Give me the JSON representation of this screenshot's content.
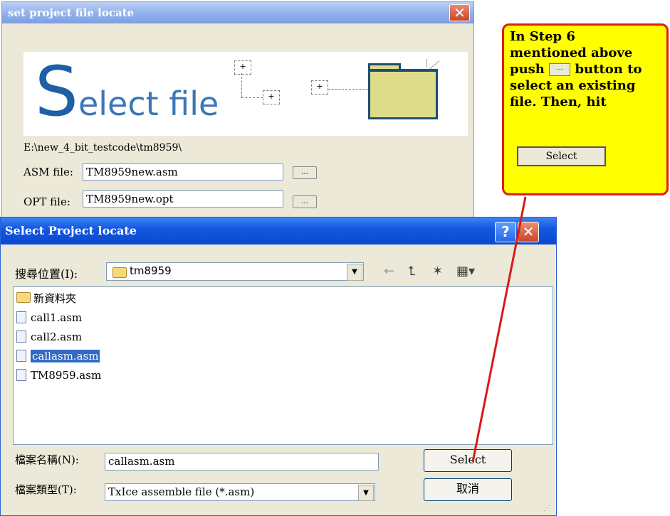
{
  "back_dialog": {
    "title": "set project file locate",
    "close_glyph": "✕",
    "banner": {
      "big_letter": "S",
      "rest": "elect file",
      "plus_glyph": "[+]"
    },
    "path": "E:\\new_4_bit_testcode\\tm8959\\",
    "asm_label": "ASM file:",
    "asm_value": "TM8959new.asm",
    "opt_label": "OPT file:",
    "opt_value": "TM8959new.opt",
    "browse_label": "..."
  },
  "callout": {
    "line1": "In Step 6",
    "line2": "mentioned above",
    "line3_pre": "push",
    "line3_post": "button to",
    "line4": "select an existing",
    "line5": "file. Then, hit",
    "mini_button": "...",
    "select_button": "Select",
    "colors": {
      "fill": "#ffff00",
      "border": "#e21b1b"
    }
  },
  "open_dialog": {
    "title": "Select Project locate",
    "help_glyph": "?",
    "close_glyph": "✕",
    "look_in_label": "搜尋位置(I):",
    "look_in_value": "tm8959",
    "toolbar_icons": [
      "back-arrow-icon",
      "up-folder-icon",
      "new-folder-icon",
      "view-menu-icon"
    ],
    "toolbar_glyphs": {
      "back": "←",
      "up": "⮤",
      "new_folder": "✶",
      "view": "▦▾"
    },
    "files": [
      {
        "name": "新資料夾",
        "type": "folder",
        "selected": false
      },
      {
        "name": "call1.asm",
        "type": "file",
        "selected": false
      },
      {
        "name": "call2.asm",
        "type": "file",
        "selected": false
      },
      {
        "name": "callasm.asm",
        "type": "file",
        "selected": true
      },
      {
        "name": "TM8959.asm",
        "type": "file",
        "selected": false
      }
    ],
    "filename_label": "檔案名稱(N):",
    "filename_value": "callasm.asm",
    "filetype_label": "檔案類型(T):",
    "filetype_value": "TxIce assemble file (*.asm)",
    "select_button": "Select",
    "cancel_button": "取消",
    "dropdown_glyph": "▼"
  }
}
